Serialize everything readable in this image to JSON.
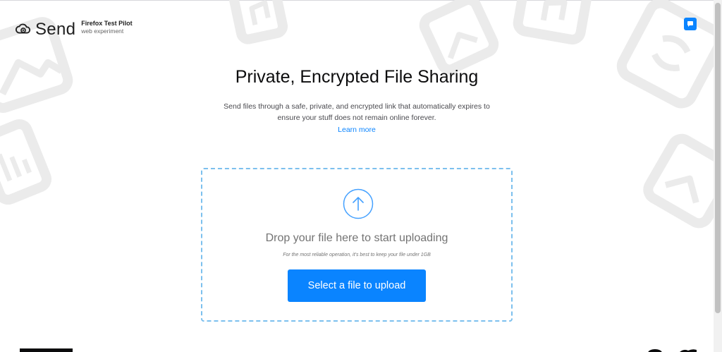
{
  "header": {
    "logo_text": "Send",
    "test_pilot_title": "Firefox Test Pilot",
    "test_pilot_subtitle": "web experiment"
  },
  "feedback_icon": "chat-bubble-icon",
  "main": {
    "title": "Private, Encrypted File Sharing",
    "description": "Send files through a safe, private, and encrypted link that automatically expires to ensure your stuff does not remain online forever.",
    "learn_more": "Learn more"
  },
  "upload": {
    "icon": "upload-arrow-icon",
    "drop_text": "Drop your file here to start uploading",
    "hint": "For the most reliable operation, it’s best to keep your file under 1GB",
    "button_label": "Select a file to upload"
  },
  "colors": {
    "accent": "#0a84ff",
    "dropzone_border": "#7cc0ee",
    "background_illustration": "#ebebeb"
  },
  "footer": {
    "icons": [
      "mozilla-logo",
      "github-icon",
      "twitter-icon"
    ]
  }
}
